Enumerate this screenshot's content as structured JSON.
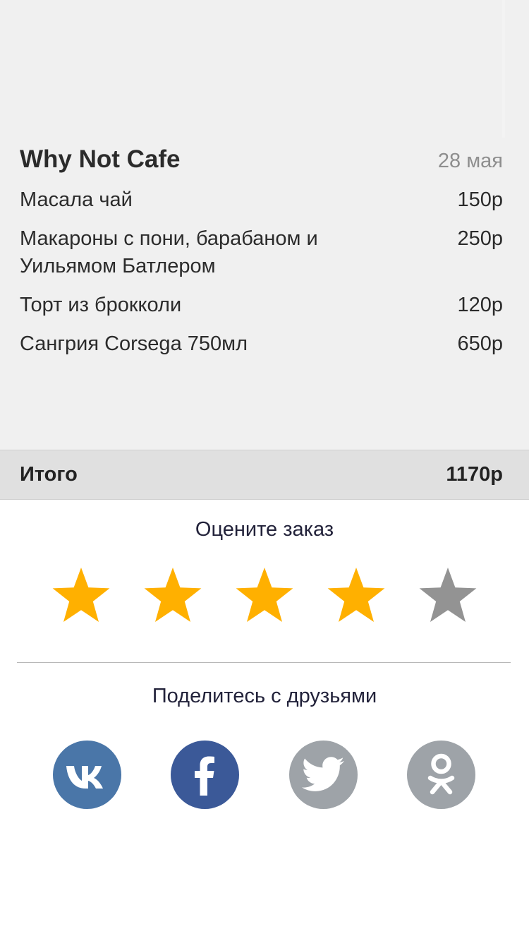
{
  "receipt": {
    "cafe_name": "Why Not Cafe",
    "date": "28 мая",
    "items": [
      {
        "name": "Масала чай",
        "price": "150р"
      },
      {
        "name": "Макароны с пони, барабаном и Уильямом Батлером",
        "price": "250р"
      },
      {
        "name": "Торт из брокколи",
        "price": "120р"
      },
      {
        "name": "Сангрия Corsega 750мл",
        "price": "650р"
      }
    ],
    "total_label": "Итого",
    "total_value": "1170р"
  },
  "rating": {
    "title": "Оцените заказ",
    "value": 4,
    "max": 5,
    "active_color": "#ffb000",
    "inactive_color": "#939393"
  },
  "share": {
    "title": "Поделитесь с друзьями",
    "networks": [
      {
        "name": "vk-icon",
        "color": "#4a76a8"
      },
      {
        "name": "facebook-icon",
        "color": "#3b5998"
      },
      {
        "name": "twitter-icon",
        "color": "#9ea3a8"
      },
      {
        "name": "odnoklassniki-icon",
        "color": "#9ea3a8"
      }
    ]
  }
}
